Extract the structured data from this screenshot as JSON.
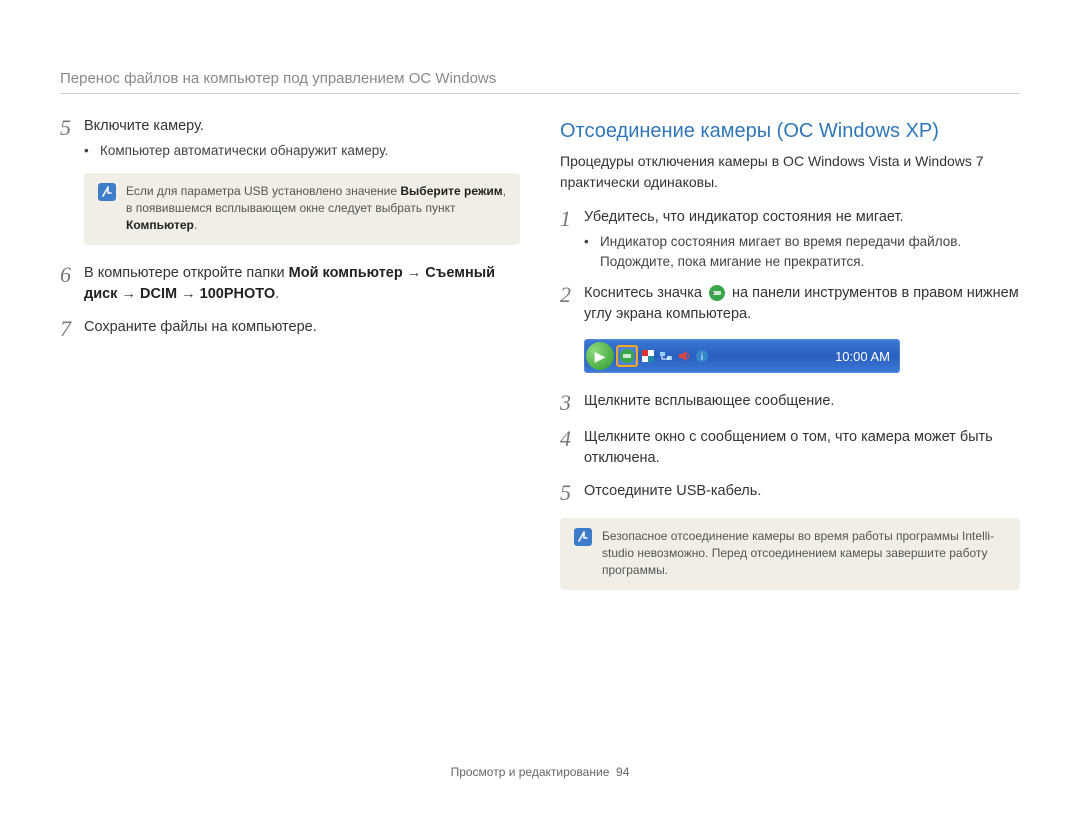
{
  "header": "Перенос файлов на компьютер под управлением ОС Windows",
  "left": {
    "steps": [
      {
        "num": "5",
        "text": "Включите камеру.",
        "bullet": "Компьютер автоматически обнаружит камеру."
      },
      {
        "num": "6",
        "prefix": "В компьютере откройте папки ",
        "bold1": "Мой компьютер",
        "arrow": " → ",
        "bold2": "Съемный диск",
        "bold3": "DCIM",
        "bold4": "100PHOTO",
        "suffix": "."
      },
      {
        "num": "7",
        "text": "Сохраните файлы на компьютере."
      }
    ],
    "note": {
      "prefix": "Если для параметра USB установлено значение ",
      "bold1": "Выберите режим",
      "mid": ", в появившемся всплывающем окне следует выбрать пункт ",
      "bold2": "Компьютер",
      "suffix": "."
    }
  },
  "right": {
    "title": "Отсоединение камеры (ОС Windows XP)",
    "intro": "Процедуры отключения камеры в ОС Windows Vista и Windows 7 практически одинаковы.",
    "steps": [
      {
        "num": "1",
        "text": "Убедитесь, что индикатор состояния не мигает.",
        "bullet": "Индикатор состояния мигает во время передачи файлов. Подождите, пока мигание не прекратится."
      },
      {
        "num": "2",
        "before": "Коснитесь значка ",
        "after": " на панели инструментов в правом нижнем углу экрана компьютера."
      },
      {
        "num": "3",
        "text": "Щелкните всплывающее сообщение."
      },
      {
        "num": "4",
        "text": "Щелкните окно с сообщением о том, что камера может быть отключена."
      },
      {
        "num": "5",
        "text": "Отсоедините USB-кабель."
      }
    ],
    "taskbar_time": "10:00 AM",
    "note": "Безопасное отсоединение камеры во время работы программы Intelli-studio невозможно. Перед отсоединением камеры завершите работу программы."
  },
  "footer": {
    "label": "Просмотр и редактирование",
    "page": "94"
  }
}
